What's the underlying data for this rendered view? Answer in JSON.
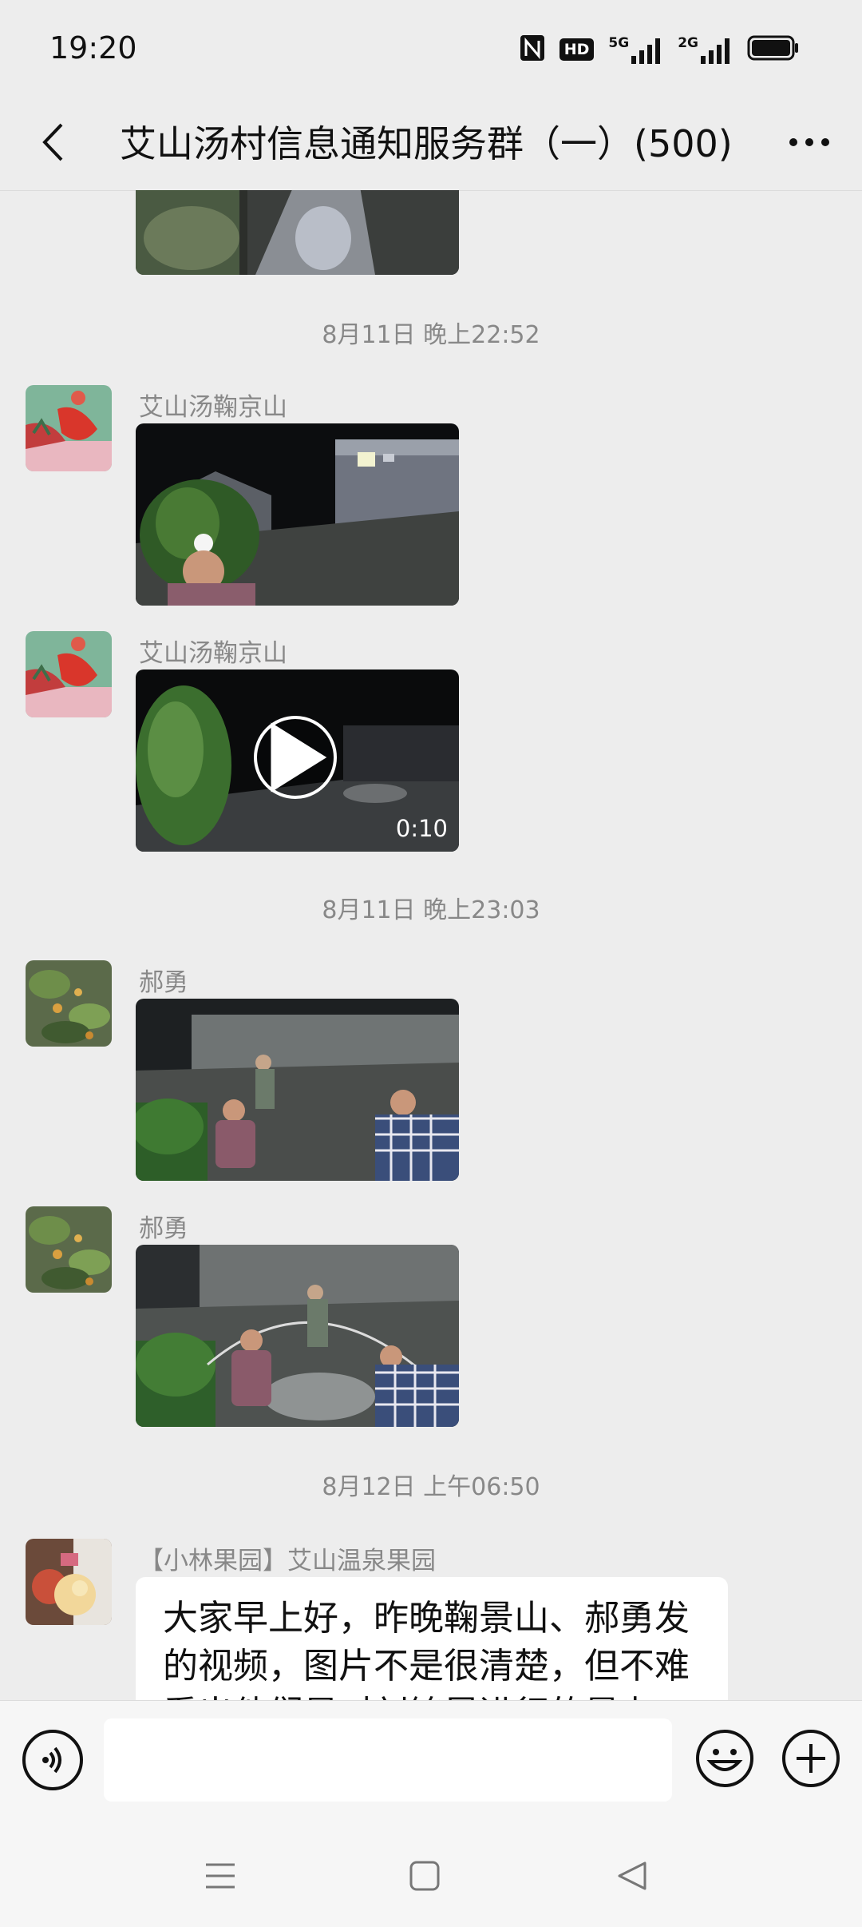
{
  "status_bar": {
    "time": "19:20",
    "icons": [
      "nfc-icon",
      "hd-icon",
      "5g-signal-icon",
      "2g-signal-icon",
      "battery-icon"
    ],
    "hd_label": "HD",
    "g5_label": "5G",
    "g2_label": "2G"
  },
  "header": {
    "title": "艾山汤村信息通知服务群（一）(500)",
    "back_icon": "chevron-left-icon",
    "more_icon": "more-dots-icon"
  },
  "messages": {
    "ts1": "8月11日 晚上22:52",
    "m1_sender": "艾山汤鞠京山",
    "m2_sender": "艾山汤鞠京山",
    "m2_duration": "0:10",
    "ts2": "8月11日 晚上23:03",
    "m3_sender": "郝勇",
    "m4_sender": "郝勇",
    "ts3": "8月12日 上午06:50",
    "m5_sender": "【小林果园】艾山温泉果园",
    "m5_text": "大家早上好，昨晚鞠景山、郝勇发的视频，图片不是很清楚，但不难看出他们是对刘铭昆进行的暴力"
  },
  "input_bar": {
    "voice_icon": "voice-icon",
    "emoji_icon": "emoji-icon",
    "plus_icon": "plus-icon"
  },
  "nav_bar": {
    "icons": [
      "menu-icon",
      "home-icon",
      "back-triangle-icon"
    ]
  },
  "colors": {
    "background": "#ededed",
    "bubble": "#ffffff",
    "timestamp": "#888888"
  }
}
